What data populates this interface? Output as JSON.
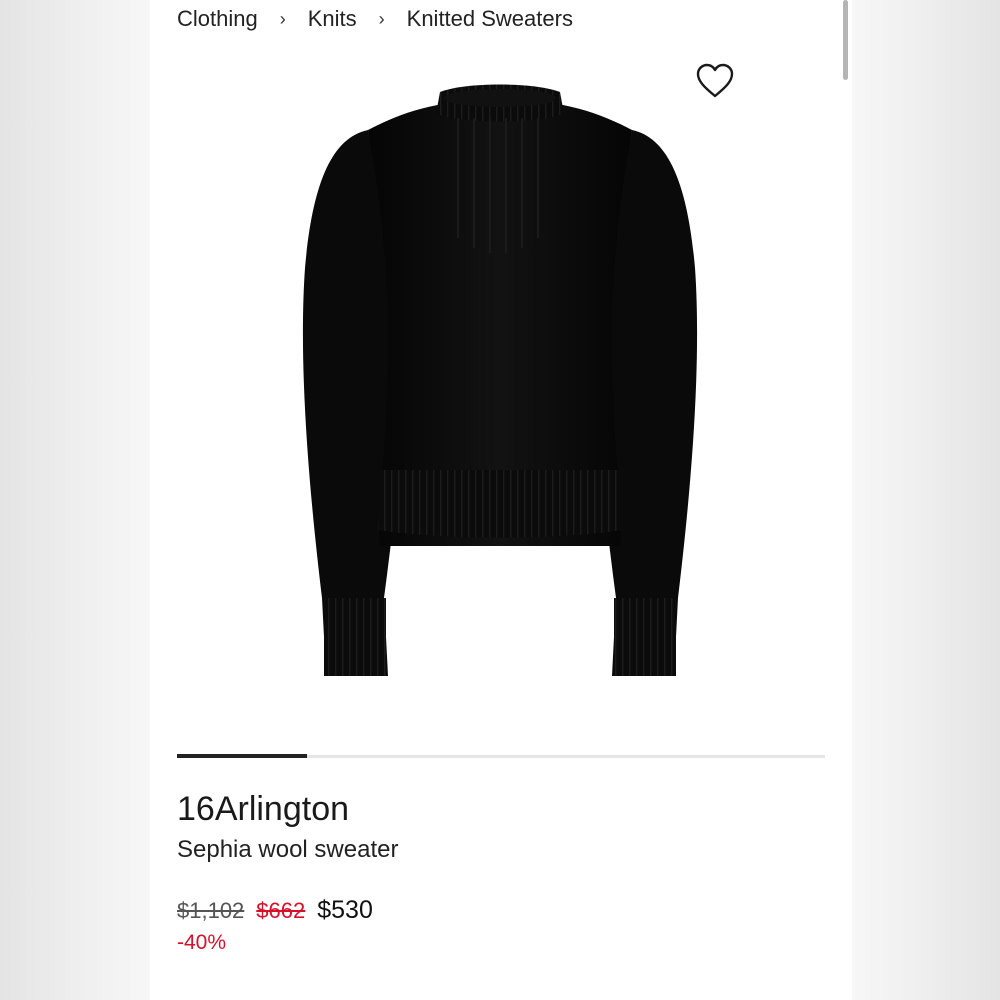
{
  "breadcrumb": {
    "items": [
      "Clothing",
      "Knits",
      "Knitted Sweaters"
    ],
    "separator": "›"
  },
  "product": {
    "brand": "16Arlington",
    "name": "Sephia wool sweater",
    "image_icon": "black-sweater-image",
    "wishlist_icon": "heart-outline-icon"
  },
  "gallery": {
    "progress_fraction": 0.2
  },
  "pricing": {
    "original": "$1,102",
    "previous": "$662",
    "current": "$530",
    "discount": "-40%",
    "sale_color": "#d8102a"
  }
}
